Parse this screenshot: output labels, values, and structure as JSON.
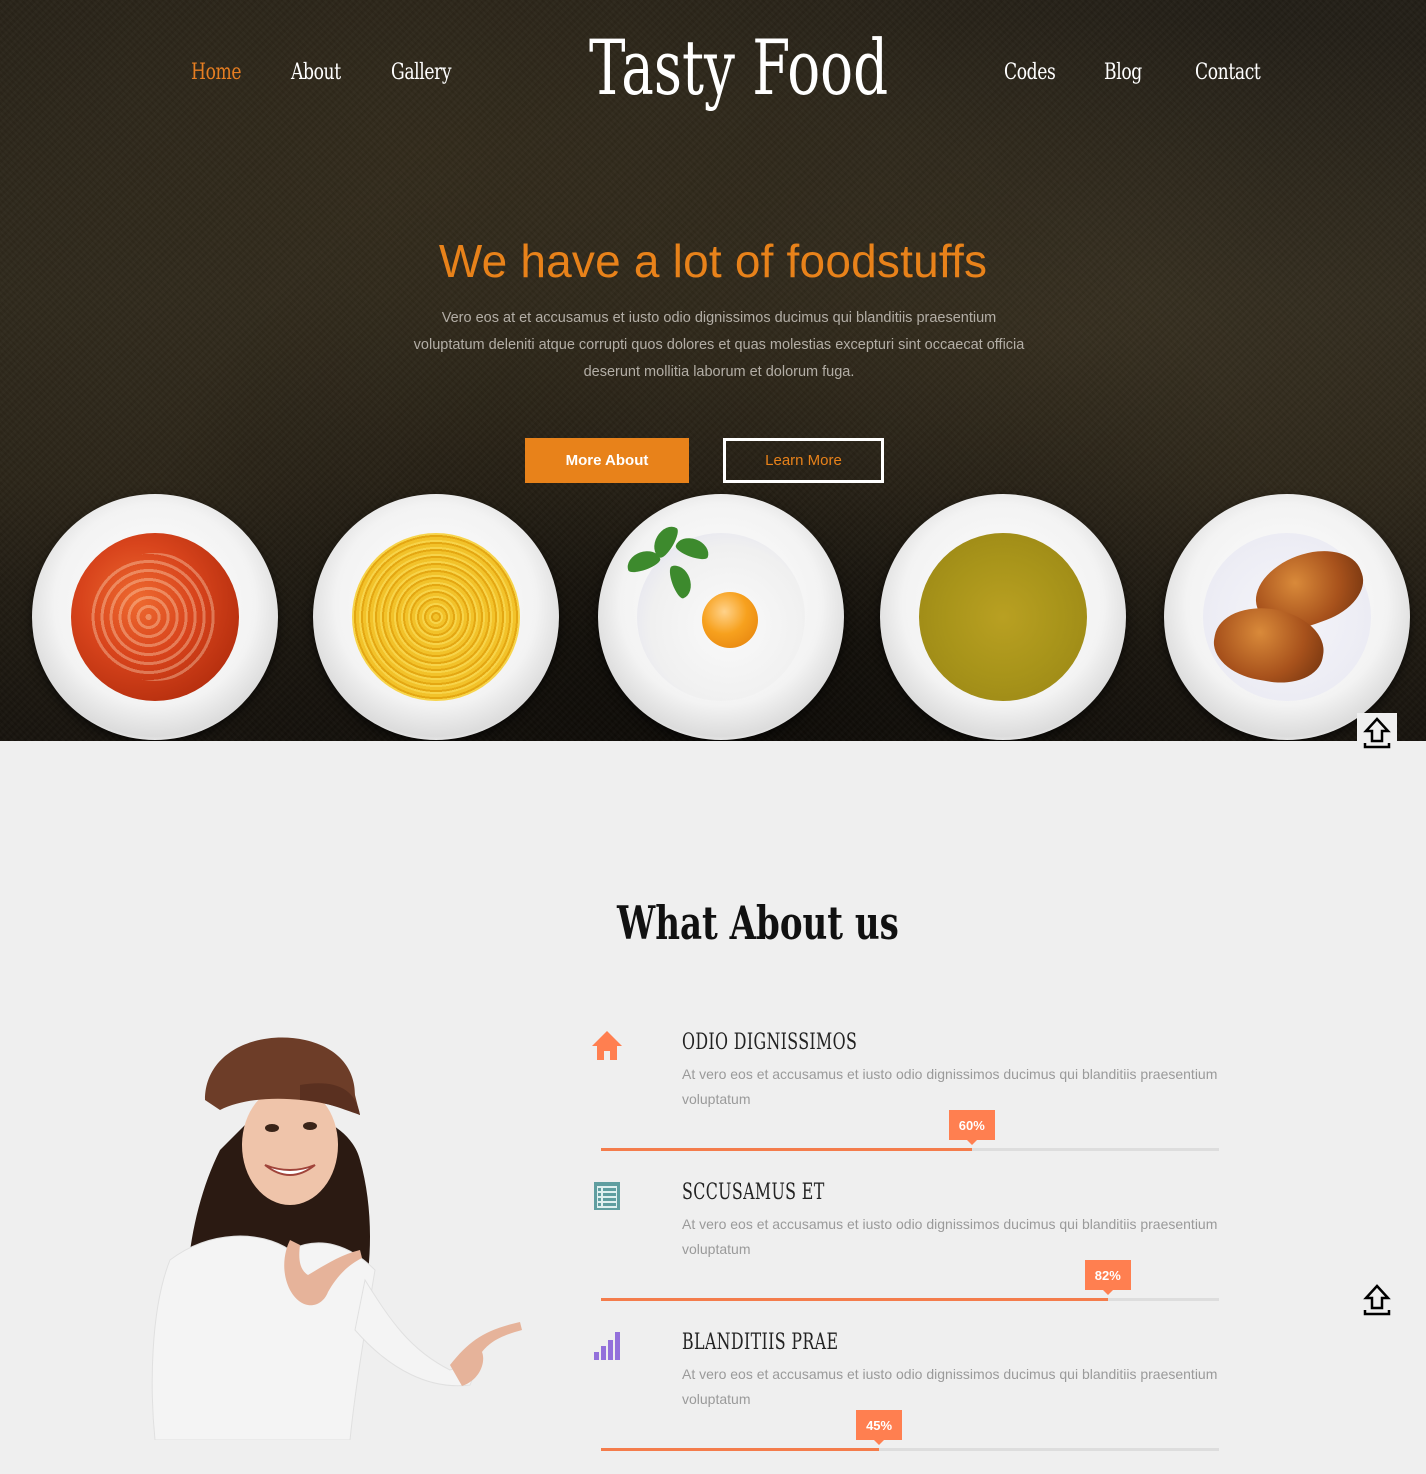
{
  "nav": {
    "left": [
      {
        "label": "Home",
        "active": true
      },
      {
        "label": "About",
        "active": false
      },
      {
        "label": "Gallery",
        "active": false
      }
    ],
    "brand": "Tasty Food",
    "right": [
      {
        "label": "Codes",
        "active": false
      },
      {
        "label": "Blog",
        "active": false
      },
      {
        "label": "Contact",
        "active": false
      }
    ]
  },
  "hero": {
    "title": "We have a lot of foodstuffs",
    "text": "Vero eos at et accusamus et iusto odio dignissimos ducimus qui blanditiis praesentium voluptatum deleniti atque corrupti quos dolores et quas molestias excepturi sint occaecat officia deserunt mollitia laborum et dolorum fuga.",
    "primary_button": "More About",
    "secondary_button": "Learn More",
    "plates": [
      "tomato-soup",
      "spaghetti",
      "fried-egg",
      "yellow-soup",
      "croissants"
    ]
  },
  "about": {
    "title": "What About us",
    "features": [
      {
        "icon": "home-icon",
        "icon_color": "#ff7f50",
        "title": "ODIO DIGNISSIMOS",
        "description": "At vero eos et accusamus et iusto odio dignissimos ducimus qui blanditiis praesentium voluptatum",
        "percent": 60,
        "percent_label": "60%"
      },
      {
        "icon": "list-icon",
        "icon_color": "#5f9ea0",
        "title": "SCCUSAMUS ET",
        "description": "At vero eos et accusamus et iusto odio dignissimos ducimus qui blanditiis praesentium voluptatum",
        "percent": 82,
        "percent_label": "82%"
      },
      {
        "icon": "signal-bars-icon",
        "icon_color": "#9370db",
        "title": "BLANDITIIS PRAE",
        "description": "At vero eos et accusamus et iusto odio dignissimos ducimus qui blanditiis praesentium voluptatum",
        "percent": 45,
        "percent_label": "45%"
      }
    ]
  },
  "colors": {
    "accent": "#e8821a",
    "progress": "#f47c4b",
    "progress_badge": "#ff7f50"
  }
}
